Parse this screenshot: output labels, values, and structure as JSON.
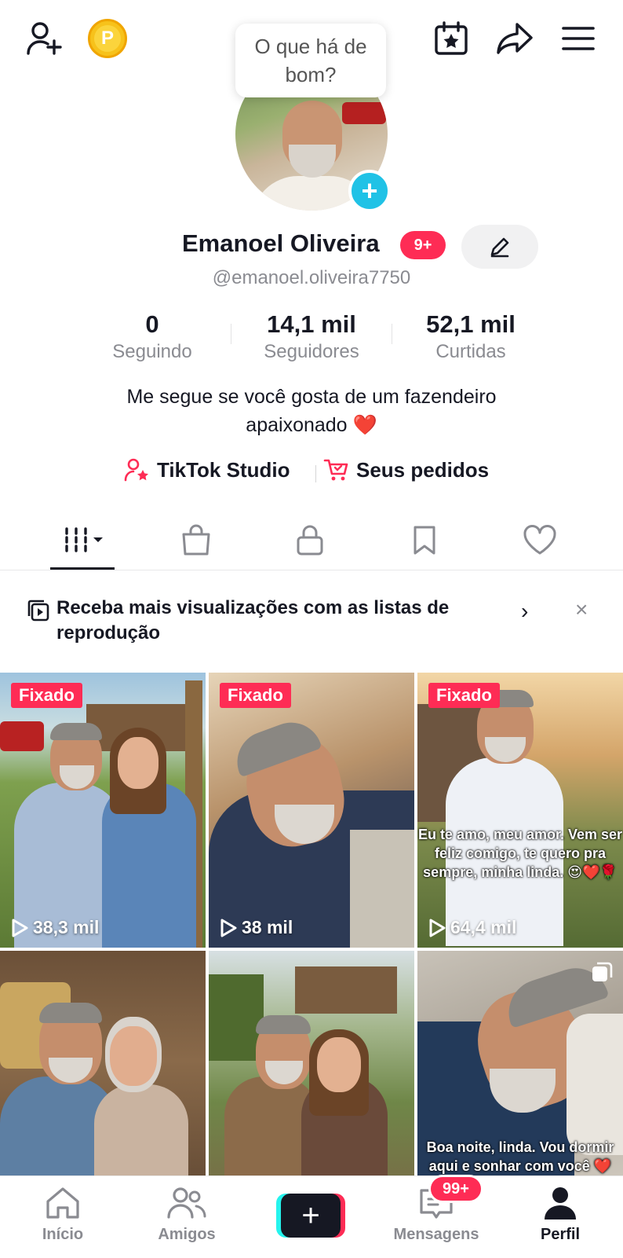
{
  "tooltip": {
    "text": "O que há de bom?"
  },
  "profile": {
    "name": "Emanoel Oliveira",
    "notification_badge": "9+",
    "handle": "@emanoel.oliveira7750",
    "bio": "Me segue se você gosta de um fazendeiro apaixonado",
    "bio_emoji": "❤️"
  },
  "stats": [
    {
      "value": "0",
      "label": "Seguindo"
    },
    {
      "value": "14,1 mil",
      "label": "Seguidores"
    },
    {
      "value": "52,1 mil",
      "label": "Curtidas"
    }
  ],
  "links": {
    "studio": "TikTok Studio",
    "orders": "Seus pedidos"
  },
  "banner": {
    "text": "Receba mais visualizações com as listas de reprodução",
    "chevron": "›",
    "close": "×"
  },
  "videos": [
    {
      "pinned": "Fixado",
      "views": "38,3 mil"
    },
    {
      "pinned": "Fixado",
      "views": "38 mil"
    },
    {
      "pinned": "Fixado",
      "views": "64,4 mil",
      "caption": "Eu te amo, meu amor. Vem ser feliz comigo, te quero pra sempre, minha linda. 😍❤️🌹"
    },
    {
      "pinned": "",
      "views": ""
    },
    {
      "pinned": "",
      "views": ""
    },
    {
      "pinned": "",
      "views": "",
      "caption": "Boa noite, linda. Vou dormir aqui e sonhar com você ❤️"
    }
  ],
  "nav": {
    "home": "Início",
    "friends": "Amigos",
    "create": "+",
    "messages": "Mensagens",
    "messages_badge": "99+",
    "profile": "Perfil"
  },
  "colors": {
    "accent": "#fe2c55",
    "cyan": "#25f4ee",
    "plus_badge": "#20c2e6",
    "text": "#161823",
    "secondary": "#8a8b91"
  }
}
